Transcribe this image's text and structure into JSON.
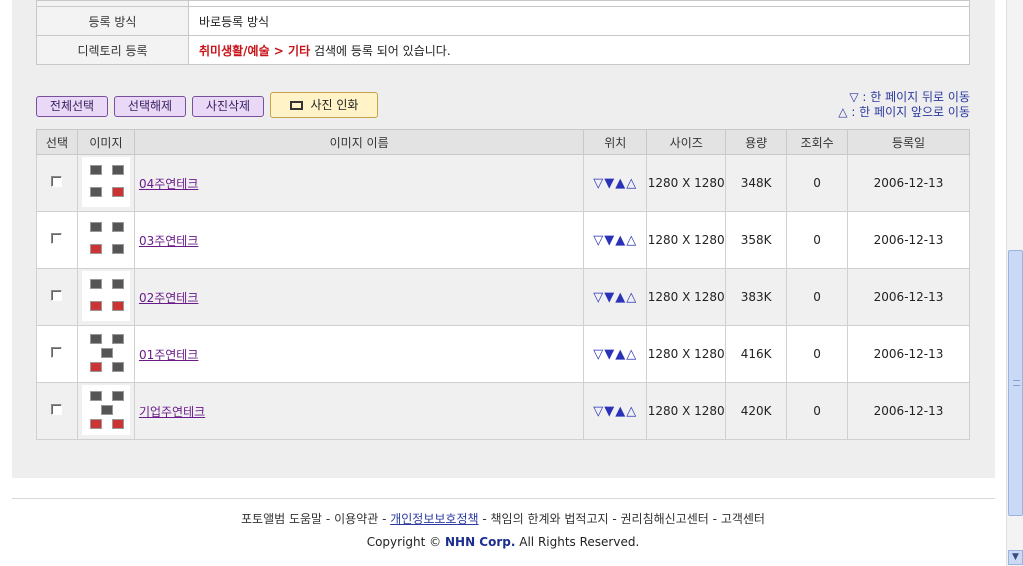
{
  "info": {
    "rows": [
      {
        "label": "등록 방식",
        "value": "바로등록 방식"
      },
      {
        "label": "디렉토리 등록",
        "category": "취미생활/예술 > 기타",
        "suffix": " 검색에 등록 되어 있습니다."
      }
    ]
  },
  "toolbar": {
    "select_all": "전체선택",
    "deselect": "선택해제",
    "delete_photo": "사진삭제",
    "print_photo": "사진 인화"
  },
  "hint": {
    "back": "▽ : 한 페이지 뒤로 이동",
    "forward": "△ : 한 페이지 앞으로 이동"
  },
  "table": {
    "headers": [
      "선택",
      "이미지",
      "이미지 이름",
      "위치",
      "사이즈",
      "용량",
      "조회수",
      "등록일"
    ],
    "rows": [
      {
        "name": "04주연테크",
        "size": "1280 X 1280",
        "bytes": "348K",
        "views": "0",
        "date": "2006-12-13"
      },
      {
        "name": "03주연테크",
        "size": "1280 X 1280",
        "bytes": "358K",
        "views": "0",
        "date": "2006-12-13"
      },
      {
        "name": "02주연테크",
        "size": "1280 X 1280",
        "bytes": "383K",
        "views": "0",
        "date": "2006-12-13"
      },
      {
        "name": "01주연테크",
        "size": "1280 X 1280",
        "bytes": "416K",
        "views": "0",
        "date": "2006-12-13"
      },
      {
        "name": "기업주연테크",
        "size": "1280 X 1280",
        "bytes": "420K",
        "views": "0",
        "date": "2006-12-13"
      }
    ],
    "position_arrows": "▽▼▲△"
  },
  "footer": {
    "links": [
      "포토앨범 도움말",
      "이용약관",
      "개인정보보호정책",
      "책임의 한계와 법적고지",
      "권리침해신고센터",
      "고객센터"
    ],
    "separator": " - ",
    "copyright_prefix": "Copyright ©",
    "company": "NHN Corp.",
    "rights": "All Rights Reserved."
  },
  "colors": {
    "category_red": "#c8151b",
    "link_purple": "#6a1b8a",
    "hint_blue": "#2b3aa0"
  }
}
